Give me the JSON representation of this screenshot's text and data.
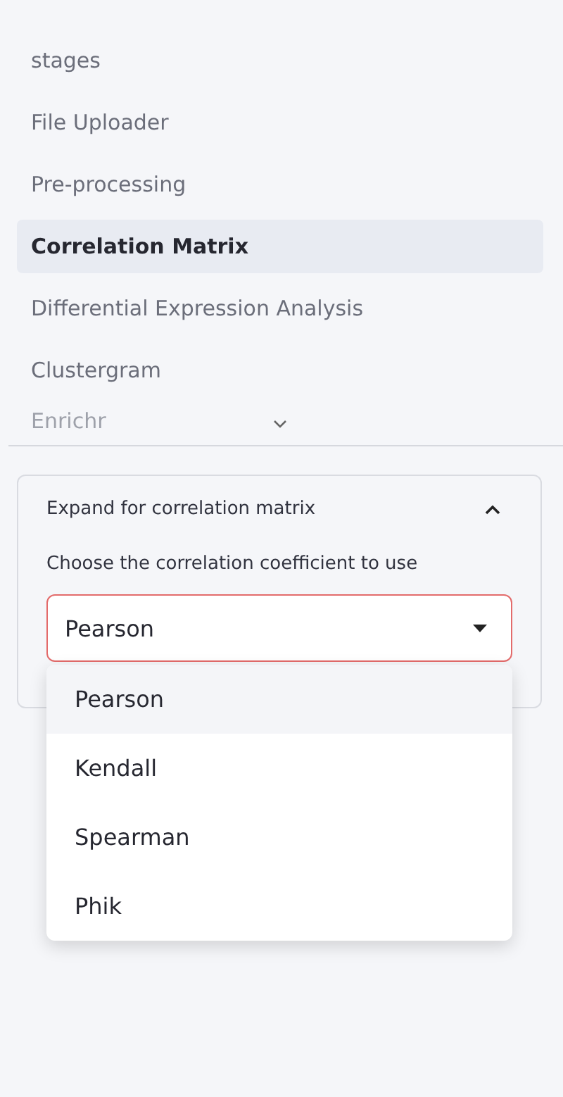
{
  "nav": {
    "items": [
      {
        "label": "stages",
        "selected": false,
        "faded": false
      },
      {
        "label": "File Uploader",
        "selected": false,
        "faded": false
      },
      {
        "label": "Pre-processing",
        "selected": false,
        "faded": false
      },
      {
        "label": "Correlation Matrix",
        "selected": true,
        "faded": false
      },
      {
        "label": "Differential Expression Analysis",
        "selected": false,
        "faded": false
      },
      {
        "label": "Clustergram",
        "selected": false,
        "faded": false
      },
      {
        "label": "Enrichr",
        "selected": false,
        "faded": true
      }
    ]
  },
  "expander": {
    "title": "Expand for correlation matrix",
    "expanded": true,
    "select": {
      "label": "Choose the correlation coefficient to use",
      "value": "Pearson",
      "open": true,
      "options": [
        {
          "label": "Pearson",
          "selected": true
        },
        {
          "label": "Kendall",
          "selected": false
        },
        {
          "label": "Spearman",
          "selected": false
        },
        {
          "label": "Phik",
          "selected": false
        }
      ]
    }
  }
}
